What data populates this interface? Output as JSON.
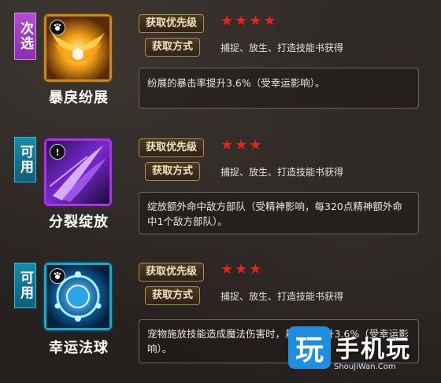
{
  "skills": [
    {
      "tag": "次选",
      "tag_color": "#b34bd0",
      "icon": "golden-wings-icon",
      "name": "暴戾纷展",
      "priority_label": "获取优先级",
      "stars": "★★★★",
      "method_label": "获取方式",
      "method": "捕捉、放生、打造技能书获得",
      "description": "纷展的暴击率提升3.6%（受幸运影响）。"
    },
    {
      "tag": "可用",
      "tag_color": "#1a8aa8",
      "icon": "purple-slash-icon",
      "name": "分裂绽放",
      "priority_label": "获取优先级",
      "stars": "★★★",
      "method_label": "获取方式",
      "method": "捕捉、放生、打造技能书获得",
      "description": "绽放额外命中敌方部队（受精神影响，每320点精神额外命中1个敌方部队）。"
    },
    {
      "tag": "可用",
      "tag_color": "#1a8aa8",
      "icon": "blue-orb-icon",
      "name": "幸运法球",
      "priority_label": "获取优先级",
      "stars": "★★★",
      "method_label": "获取方式",
      "method": "捕捉、放生、打造技能书获得",
      "description": "宠物施放技能造成魔法伤害时，暴击率提升3.6%（受幸运影响）。"
    }
  ],
  "watermark": {
    "logo_char": "玩",
    "title": "手机玩",
    "url": "ShouJiWan.Com"
  },
  "colors": {
    "star": "#e8221e",
    "pill_border": "#b58a4a",
    "watermark_blue": "#1f8ee0"
  }
}
